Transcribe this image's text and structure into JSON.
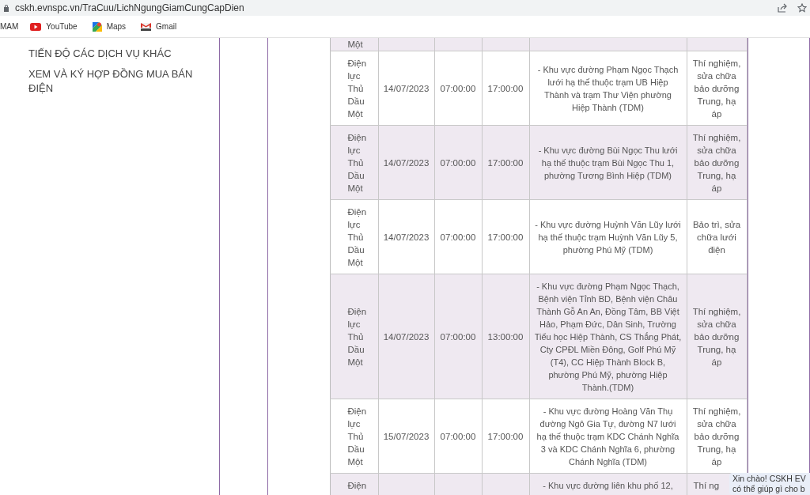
{
  "browser": {
    "url": "cskh.evnspc.vn/TraCuu/LichNgungGiamCungCapDien"
  },
  "bookmarks": [
    {
      "label": "MAM",
      "kind": "plain"
    },
    {
      "label": "YouTube",
      "kind": "youtube"
    },
    {
      "label": "Maps",
      "kind": "maps"
    },
    {
      "label": "Gmail",
      "kind": "gmail"
    }
  ],
  "sidebar": {
    "items": [
      "TIẾN ĐỘ CÁC DỊCH VỤ KHÁC",
      "XEM VÀ KÝ HỢP ĐỒNG MUA BÁN ĐIỆN"
    ]
  },
  "table": {
    "rows": [
      {
        "kind": "partial",
        "office": "Một"
      },
      {
        "kind": "full",
        "office": "Điện lực Thủ Dầu Một",
        "date": "14/07/2023",
        "start": "07:00:00",
        "end": "17:00:00",
        "area": "- Khu vực đường Phạm Ngọc Thạch lưới hạ thế thuộc trạm UB Hiệp Thành và trạm Thư Viện phường Hiệp Thành (TDM)",
        "work": "Thí nghiệm, sửa chữa bảo dưỡng Trung, hạ áp"
      },
      {
        "kind": "full",
        "office": "Điện lực Thủ Dầu Một",
        "date": "14/07/2023",
        "start": "07:00:00",
        "end": "17:00:00",
        "area": "- Khu vực đường Bùi Ngọc Thu lưới hạ thế thuộc trạm Bùi Ngọc Thu 1, phường Tương Bình Hiệp (TDM)",
        "work": "Thí nghiệm, sửa chữa bảo dưỡng Trung, hạ áp"
      },
      {
        "kind": "full",
        "office": "Điện lực Thủ Dầu Một",
        "date": "14/07/2023",
        "start": "07:00:00",
        "end": "17:00:00",
        "area": "- Khu vực đường Huỳnh Văn Lũy lưới hạ thế thuộc trạm Huỳnh Văn Lũy 5, phường Phú Mỹ (TDM)",
        "work": "Bảo trì, sửa chữa lưới điện"
      },
      {
        "kind": "full",
        "office": "Điện lực Thủ Dầu Một",
        "date": "14/07/2023",
        "start": "07:00:00",
        "end": "13:00:00",
        "area": "- Khu vực đường Phạm Ngọc Thạch, Bệnh viện Tỉnh BD, Bệnh viện Châu Thành Gỗ An An, Đồng Tâm, BB Việt Hảo, Phạm Đức, Dân Sinh, Trường Tiểu học Hiệp Thành, CS Thắng Phát, Cty CPĐL Miền Đông, Golf Phú Mỹ (T4), CC Hiệp Thành Block B, phường Phú Mỹ, phường Hiệp Thành.(TDM)",
        "work": "Thí nghiệm, sửa chữa bảo dưỡng Trung, hạ áp"
      },
      {
        "kind": "full",
        "office": "Điện lực Thủ Dầu Một",
        "date": "15/07/2023",
        "start": "07:00:00",
        "end": "17:00:00",
        "area": "- Khu vực đường Hoàng Văn Thụ đường Ngô Gia Tự, đường N7 lưới hạ thế thuộc trạm KDC Chánh Nghĩa 3 và KDC Chánh Nghĩa 6, phường Chánh Nghĩa (TDM)",
        "work": "Thí nghiệm, sửa chữa bảo dưỡng Trung, hạ áp"
      },
      {
        "kind": "cut",
        "office": "Điện",
        "area": "- Khu vực đường liên khu phố 12,",
        "work": "Thí ng"
      }
    ]
  },
  "chat": {
    "lines": [
      "Xin chào! CSKH EV",
      "có thể giúp gì cho b"
    ]
  }
}
